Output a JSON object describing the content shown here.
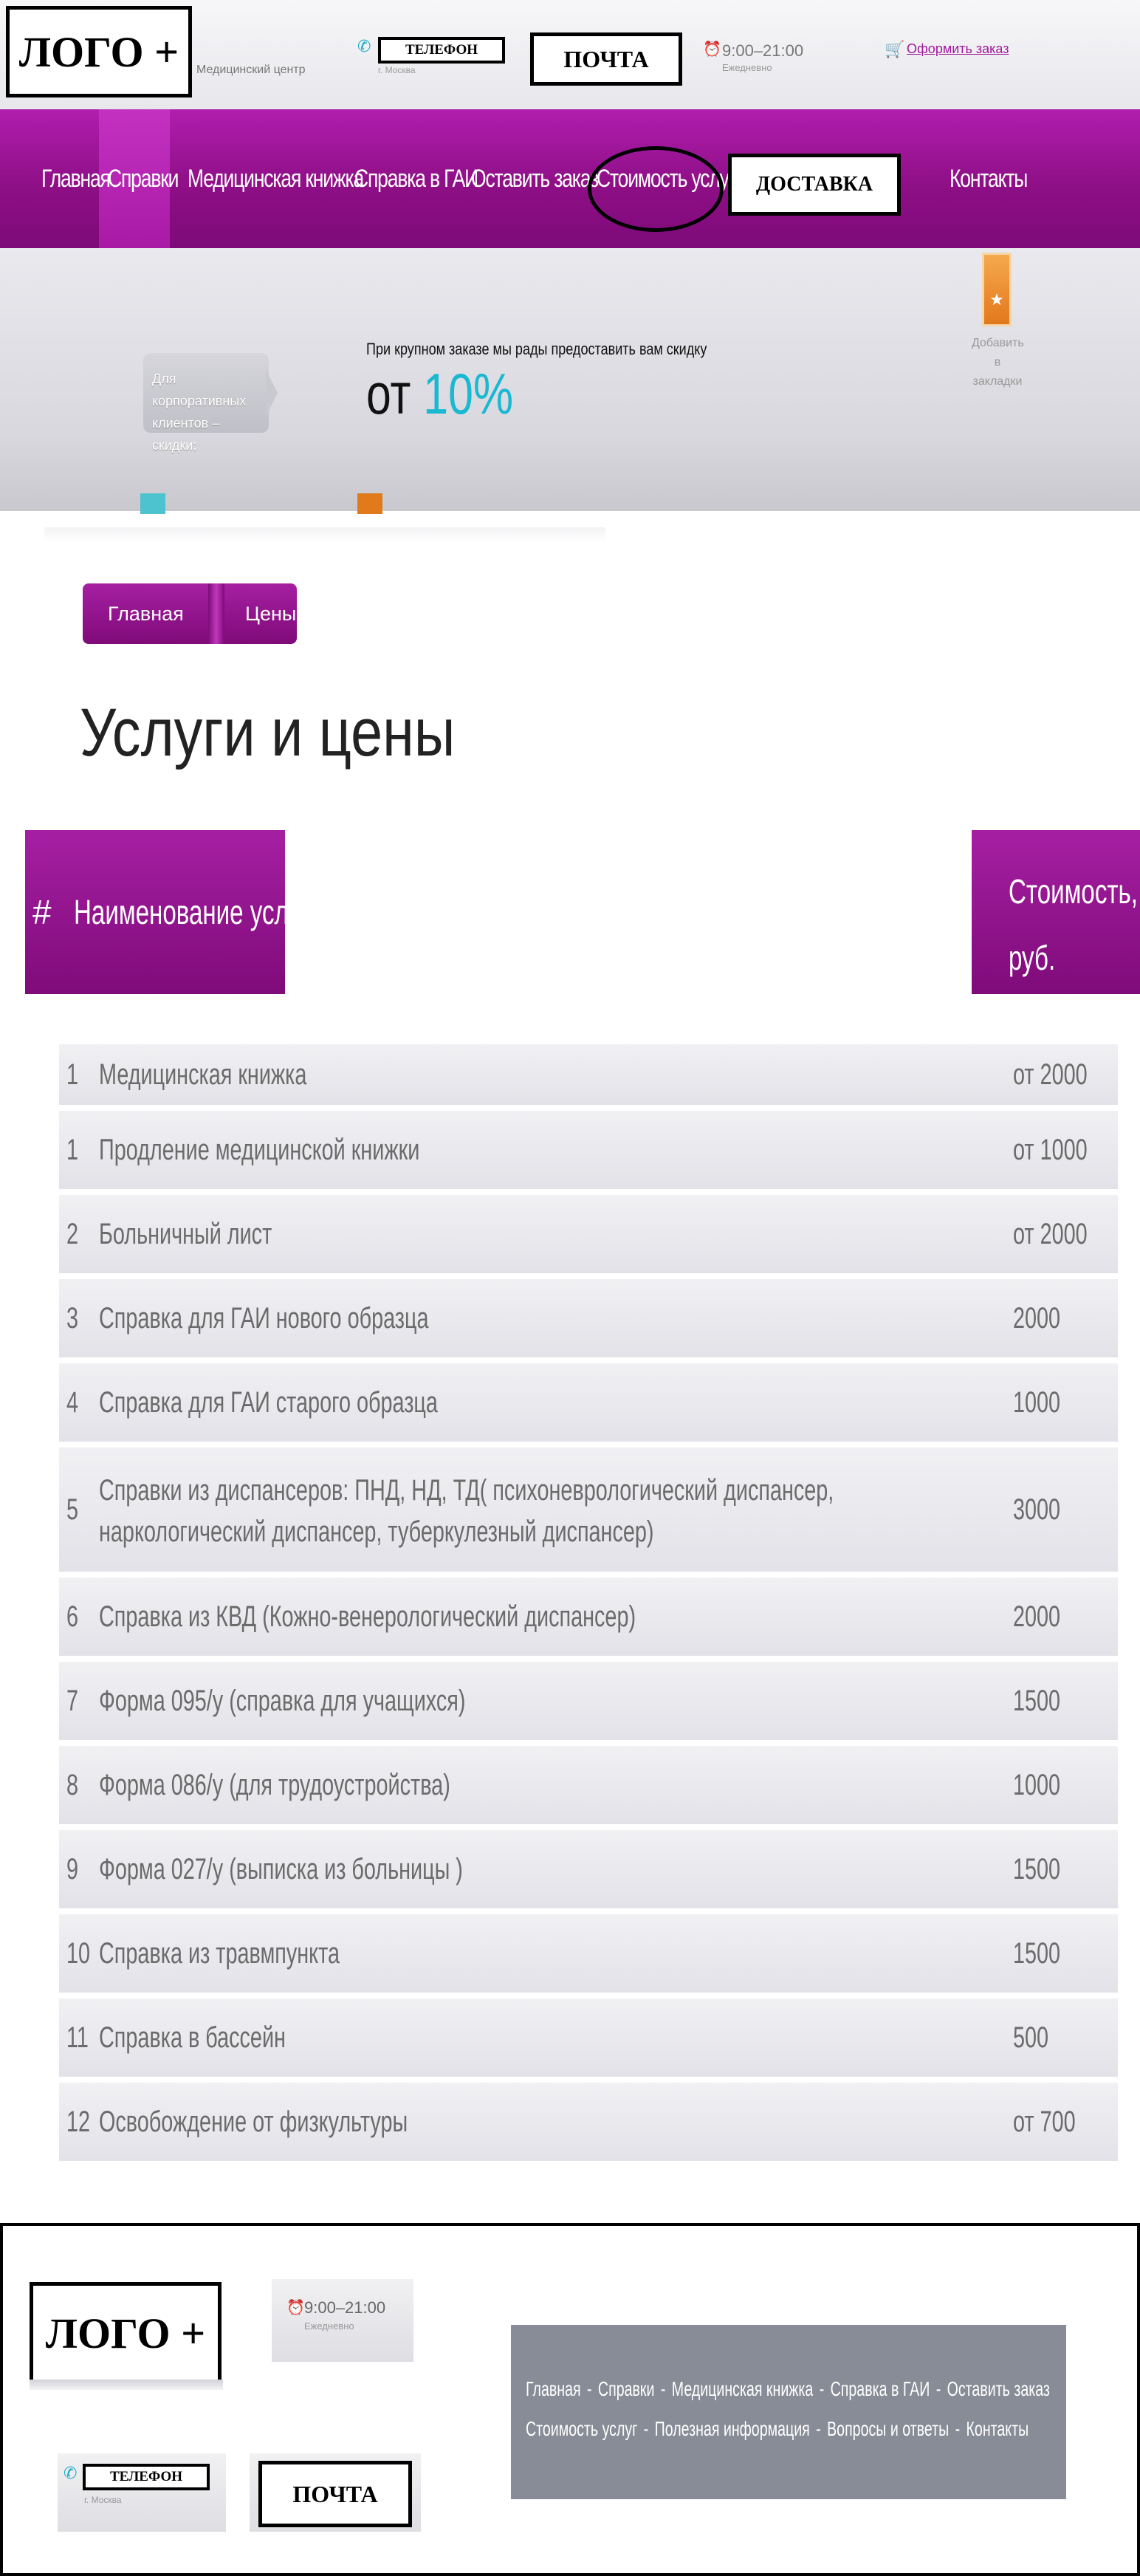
{
  "header": {
    "logo": "ЛОГО +",
    "subtitle": "Медицинский центр",
    "phone": "ТЕЛЕФОН",
    "city": "г. Москва",
    "mail": "ПОЧТА",
    "hours": "9:00–21:00",
    "hours_note": "Ежедневно",
    "order_link": "Оформить заказ",
    "icons": {
      "phone": "phone-icon",
      "clock": "clock-icon",
      "cart": "cart-icon"
    }
  },
  "nav": {
    "items": [
      "Главная",
      "Справки",
      "Медицинская книжка",
      "Справка в ГАИ",
      "Оставить заказ",
      "Стоимость услуг",
      "ДОСТАВКА",
      "Контакты"
    ],
    "active": "Справки",
    "accent": "#8e0f86"
  },
  "banner": {
    "corp_tag": "Для корпоративных клиентов – скидки:",
    "small_text": "При крупном заказе мы рады предоставить вам скидку",
    "ot": "от",
    "discount": "10%",
    "favorite_label": "Добавить в закладки",
    "discount_color": "#1bb8d2"
  },
  "breadcrumb": {
    "home": "Главная",
    "current": "Цены"
  },
  "page_title": "Услуги и цены",
  "table": {
    "headers": {
      "hash": "#",
      "name": "Наименование услуги",
      "price": "Стоимость, руб."
    },
    "rows": [
      {
        "num": "1",
        "name": "Медицинская книжка",
        "price": "от 2000"
      },
      {
        "num": "1",
        "name": "Продление медицинской книжки",
        "price": "от 1000"
      },
      {
        "num": "2",
        "name": "Больничный лист",
        "price": "от 2000"
      },
      {
        "num": "3",
        "name": "Справка для ГАИ нового образца",
        "price": "2000"
      },
      {
        "num": "4",
        "name": "Справка для ГАИ старого образца",
        "price": "1000"
      },
      {
        "num": "5",
        "name": "Справки из диспансеров: ПНД, НД, ТД( психоневрологический диспансер, наркологический диспансер, туберкулезный диспансер)",
        "price": "3000"
      },
      {
        "num": "6",
        "name": "Справка из КВД (Кожно-венерологический диспансер)",
        "price": "2000"
      },
      {
        "num": "7",
        "name": "Форма 095/у (справка для учащихся)",
        "price": "1500"
      },
      {
        "num": "8",
        "name": "Форма 086/у (для трудоустройства)",
        "price": "1000"
      },
      {
        "num": "9",
        "name": "Форма 027/у (выписка из больницы )",
        "price": "1500"
      },
      {
        "num": "10",
        "name": "Справка из травмпункта",
        "price": "1500"
      },
      {
        "num": "11",
        "name": "Справка в бассейн",
        "price": "500"
      },
      {
        "num": "12",
        "name": "Освобождение от физкультуры",
        "price": "от 700"
      }
    ]
  },
  "footer": {
    "logo": "ЛОГО +",
    "hours": "9:00–21:00",
    "hours_note": "Ежедневно",
    "phone": "ТЕЛЕФОН",
    "city": "г. Москва",
    "mail": "ПОЧТА",
    "menu_line1": [
      "Главная",
      "Справки",
      "Медицинская книжка",
      "Справка в ГАИ",
      "Оставить заказ"
    ],
    "menu_line2": [
      "Стоимость услуг",
      "Полезная информация",
      "Вопросы и ответы",
      "Контакты"
    ]
  }
}
